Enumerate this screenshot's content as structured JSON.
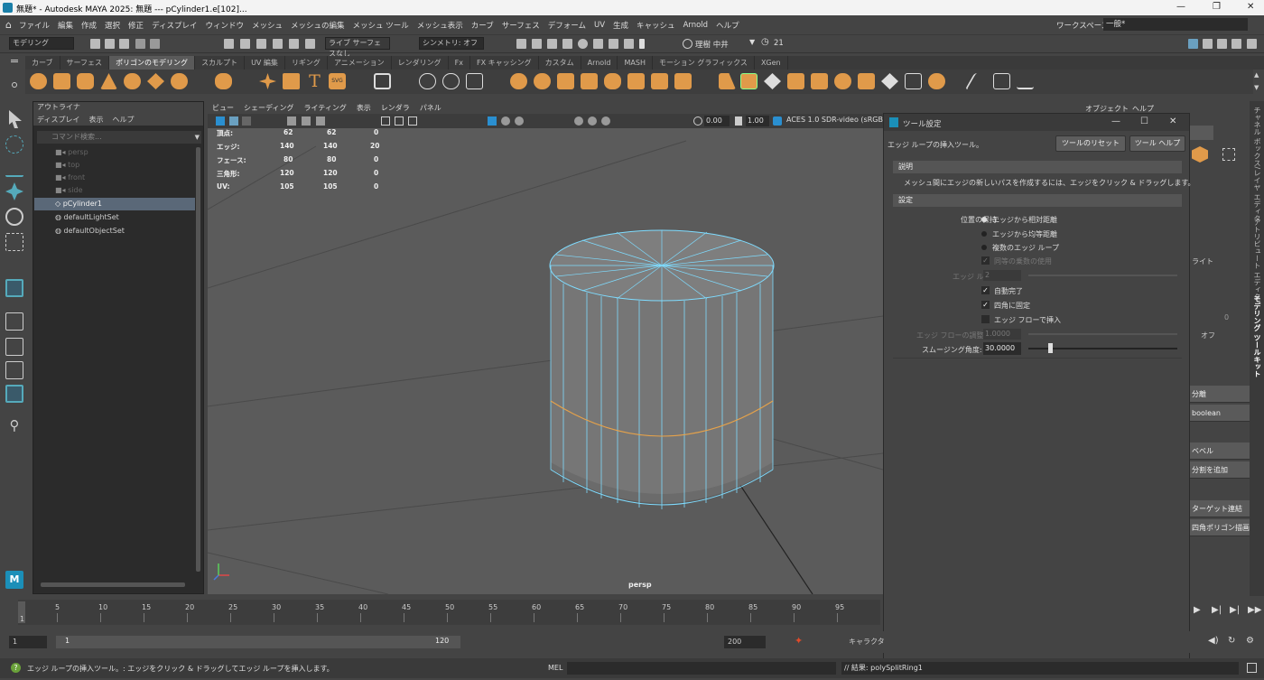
{
  "window": {
    "title": "無題* - Autodesk MAYA 2025: 無題   ---   pCylinder1.e[102]..."
  },
  "menu": [
    "ファイル",
    "編集",
    "作成",
    "選択",
    "修正",
    "ディスプレイ",
    "ウィンドウ",
    "メッシュ",
    "メッシュの編集",
    "メッシュ ツール",
    "メッシュ表示",
    "カーブ",
    "サーフェス",
    "デフォーム",
    "UV",
    "生成",
    "キャッシュ",
    "Arnold",
    "ヘルプ"
  ],
  "workspace": {
    "label": "ワークスペース:",
    "value": "一般*"
  },
  "status": {
    "mode": "モデリング",
    "live": "ライブ サーフェスなし",
    "symmetry": "シンメトリ: オフ",
    "user": "理樹 中井",
    "notif": "21"
  },
  "shelf_tabs": [
    "カーブ",
    "サーフェス",
    "ポリゴンのモデリング",
    "スカルプト",
    "UV 編集",
    "リギング",
    "アニメーション",
    "レンダリング",
    "Fx",
    "FX キャッシング",
    "カスタム",
    "Arnold",
    "MASH",
    "モーション グラフィックス",
    "XGen"
  ],
  "outliner": {
    "title": "アウトライナ",
    "menu": [
      "ディスプレイ",
      "表示",
      "ヘルプ"
    ],
    "search": "コマンド検索...",
    "items": [
      "persp",
      "top",
      "front",
      "side",
      "pCylinder1",
      "defaultLightSet",
      "defaultObjectSet"
    ]
  },
  "viewport": {
    "menu": [
      "ビュー",
      "シェーディング",
      "ライティング",
      "表示",
      "レンダラ",
      "パネル"
    ],
    "exposure": "0.00",
    "gamma": "1.00",
    "colorspace": "ACES 1.0 SDR-video (sRGB",
    "camera": "persp",
    "hud": [
      {
        "k": "頂点:",
        "a": "62",
        "b": "62",
        "c": "0"
      },
      {
        "k": "エッジ:",
        "a": "140",
        "b": "140",
        "c": "20"
      },
      {
        "k": "フェース:",
        "a": "80",
        "b": "80",
        "c": "0"
      },
      {
        "k": "三角形:",
        "a": "120",
        "b": "120",
        "c": "0"
      },
      {
        "k": "UV:",
        "a": "105",
        "b": "105",
        "c": "0"
      }
    ]
  },
  "tool": {
    "title": "ツール設定",
    "name": "エッジ ループの挿入ツール。",
    "reset": "ツールのリセット",
    "help": "ツール ヘルプ",
    "desc_header": "説明",
    "desc": "メッシュ間にエッジの新しいパスを作成するには、エッジをクリック & ドラッグします。",
    "settings_header": "設定",
    "maintain_label": "位置の保持:",
    "opt1": "エッジから相対距離",
    "opt2": "エッジから均等距離",
    "opt3": "複数のエッジ ループ",
    "equal_mult": "同等の乗数の使用",
    "loops_label": "エッジ ループ数:",
    "loops_val": "2",
    "auto": "自動完了",
    "fix_quads": "四角に固定",
    "flow": "エッジ フローで挿入",
    "flow_adj_label": "エッジ フローの調整",
    "flow_adj_val": "1.0000",
    "smooth_label": "スムージング角度:",
    "smooth_val": "30.0000"
  },
  "rightpanel": {
    "tabs": [
      "オブジェクト",
      "ヘルプ"
    ],
    "items": [
      "ライト",
      "オフ",
      "分離",
      "boolean",
      "ベベル",
      "分割を追加",
      "ターゲット連結",
      "四角ポリゴン描画"
    ],
    "vert": [
      "チャネル ボックス/レイヤ エディタ",
      "アトリビュート エディタ",
      "モデリング ツールキット"
    ],
    "zero": "0"
  },
  "timeline": {
    "ticks": [
      "1",
      "5",
      "10",
      "15",
      "20",
      "25",
      "30",
      "35",
      "40",
      "45",
      "50",
      "55",
      "60",
      "65",
      "70",
      "75",
      "80",
      "85",
      "90",
      "95"
    ],
    "start": "1",
    "range_start": "1",
    "range_end": "120",
    "end": "200",
    "char": "キャラクタ"
  },
  "cmd": {
    "help": "エッジ ループの挿入ツール。: エッジをクリック & ドラッグしてエッジ ループを挿入します。",
    "lang": "MEL",
    "result": "// 結果: polySplitRing1"
  }
}
